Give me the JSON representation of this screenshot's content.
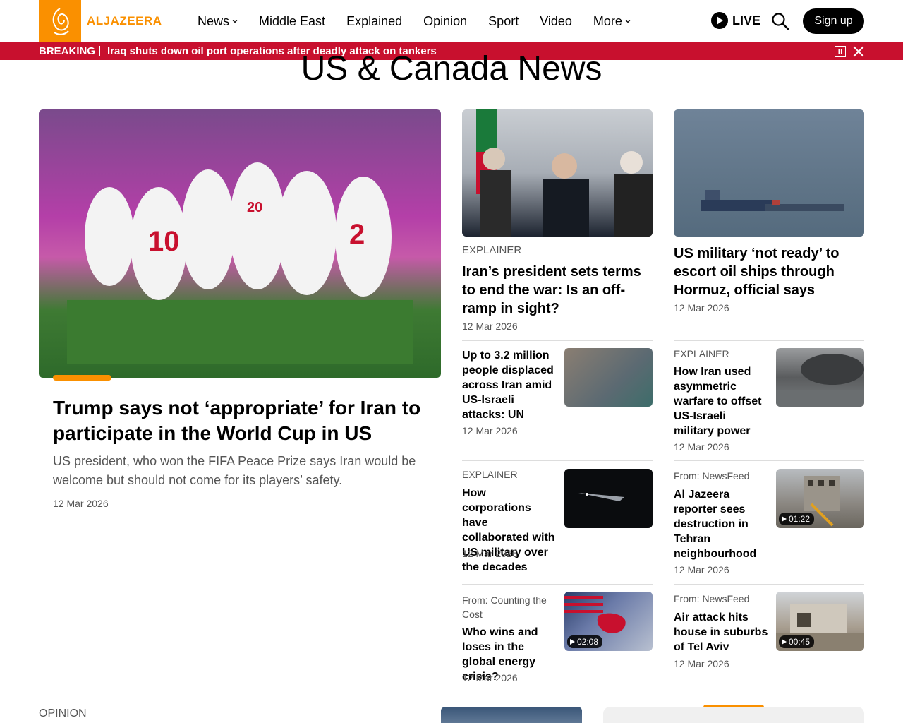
{
  "header": {
    "logo_text": "ALJAZEERA",
    "nav": [
      {
        "label": "News",
        "has_dropdown": true
      },
      {
        "label": "Middle East",
        "has_dropdown": false
      },
      {
        "label": "Explained",
        "has_dropdown": false
      },
      {
        "label": "Opinion",
        "has_dropdown": false
      },
      {
        "label": "Sport",
        "has_dropdown": false
      },
      {
        "label": "Video",
        "has_dropdown": false
      },
      {
        "label": "More",
        "has_dropdown": true
      }
    ],
    "live_label": "LIVE",
    "signup_label": "Sign up"
  },
  "breaking": {
    "label": "BREAKING",
    "text": "Iraq shuts down oil port operations after deadly attack on tankers"
  },
  "page_title": "US & Canada News",
  "feature": {
    "headline": "Trump says not ‘appropriate’ for Iran to participate in the World Cup in US",
    "summary": "US president, who won the FIFA Peace Prize says Iran would be welcome but should not come for its players’ safety.",
    "date": "12 Mar 2026"
  },
  "col2_top": {
    "kicker": "EXPLAINER",
    "headline": "Iran’s president sets terms to end the war: Is an off-ramp in sight?",
    "date": "12 Mar 2026"
  },
  "col3_top": {
    "headline": "US military ‘not ready’ to escort oil ships through Hormuz, official says",
    "date": "12 Mar 2026"
  },
  "col2_items": [
    {
      "kicker": "",
      "headline": "Up to 3.2 million people displaced across Iran amid US-Israeli attacks: UN",
      "date": "12 Mar 2026",
      "duration": ""
    },
    {
      "kicker": "EXPLAINER",
      "headline": "How corporations have collaborated with US military over the decades",
      "date": "12 Mar 2026",
      "duration": ""
    },
    {
      "kicker": "From: Counting the Cost",
      "headline": "Who wins and loses in the global energy crisis?",
      "date": "12 Mar 2026",
      "duration": "02:08"
    }
  ],
  "col3_items": [
    {
      "kicker": "EXPLAINER",
      "headline": "How Iran used asymmetric warfare to offset US-Israeli military power",
      "date": "12 Mar 2026",
      "duration": ""
    },
    {
      "kicker": "From: NewsFeed",
      "headline": "Al Jazeera reporter sees destruction in Tehran neighbourhood",
      "date": "12 Mar 2026",
      "duration": "01:22"
    },
    {
      "kicker": "From: NewsFeed",
      "headline": "Air attack hits house in suburbs of Tel Aviv",
      "date": "12 Mar 2026",
      "duration": "00:45"
    }
  ],
  "opinion_kicker": "OPINION",
  "colors": {
    "brand": "#fa9000",
    "breaking": "#c8102e"
  }
}
